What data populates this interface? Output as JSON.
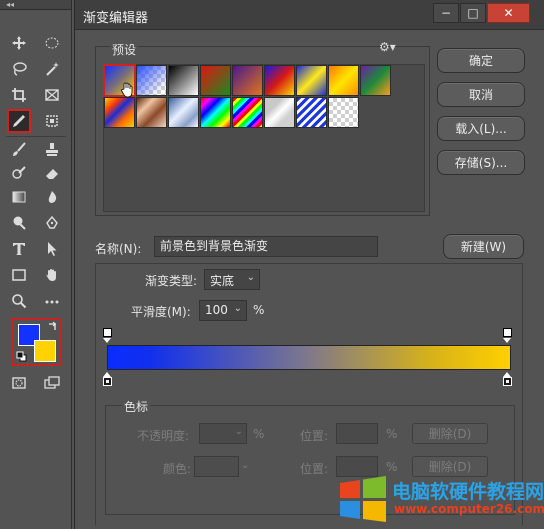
{
  "tools_panel": {
    "collapse_glyph": "◂◂",
    "foreground_color": "#1132ff",
    "background_color": "#ffd200",
    "tools": [
      {
        "name": "move-icon",
        "glyph": "✥"
      },
      {
        "name": "marquee-icon",
        "glyph": "◌"
      },
      {
        "name": "lasso-icon",
        "glyph": "ζ"
      },
      {
        "name": "magic-wand-icon",
        "glyph": "✨"
      },
      {
        "name": "crop-icon",
        "glyph": "⬚"
      },
      {
        "name": "frame-icon",
        "glyph": "☒"
      },
      {
        "name": "eyedropper-icon",
        "glyph": "✒"
      },
      {
        "name": "patch-icon",
        "glyph": "▣"
      },
      {
        "name": "brush-icon",
        "glyph": "✎"
      },
      {
        "name": "stamp-icon",
        "glyph": "☗"
      },
      {
        "name": "history-brush-icon",
        "glyph": "✑"
      },
      {
        "name": "eraser-icon",
        "glyph": "▭"
      },
      {
        "name": "gradient-tool-icon",
        "glyph": "▧"
      },
      {
        "name": "blur-icon",
        "glyph": "☂"
      },
      {
        "name": "dodge-icon",
        "glyph": "●"
      },
      {
        "name": "pen-icon",
        "glyph": "✒"
      },
      {
        "name": "type-icon",
        "glyph": "T"
      },
      {
        "name": "path-select-icon",
        "glyph": "➤"
      },
      {
        "name": "rectangle-icon",
        "glyph": "▭"
      },
      {
        "name": "hand-icon",
        "glyph": "✋"
      },
      {
        "name": "zoom-icon",
        "glyph": "⚲"
      },
      {
        "name": "more-tools-icon",
        "glyph": "•••"
      }
    ]
  },
  "dialog": {
    "title": "渐变编辑器",
    "window_controls": {
      "minimize": "−",
      "maximize": "□",
      "close": "✕"
    },
    "presets_label": "预设",
    "gear_glyph": "⚙▾",
    "buttons": {
      "ok": "确定",
      "cancel": "取消",
      "load": "载入(L)...",
      "save": "存储(S)...",
      "new": "新建(W)"
    },
    "name_label": "名称(N):",
    "name_value": "前景色到背景色渐变",
    "gradient_type_label": "渐变类型:",
    "gradient_type_value": "实底",
    "smoothness_label": "平滑度(M):",
    "smoothness_value": "100",
    "smoothness_unit": "%",
    "color_stops_label": "色标",
    "opacity_label": "不透明度:",
    "opacity_unit": "%",
    "location_label_1": "位置:",
    "location_unit_1": "%",
    "delete_label_1": "删除(D)",
    "color_label": "颜色:",
    "location_label_2": "位置:",
    "location_unit_2": "%",
    "delete_label_2": "删除(D)",
    "gradient_colors": {
      "start": "#0b2cff",
      "end": "#ffd000"
    }
  },
  "watermark": {
    "title": "电脑软硬件教程网",
    "url": "www.computer26.com"
  }
}
